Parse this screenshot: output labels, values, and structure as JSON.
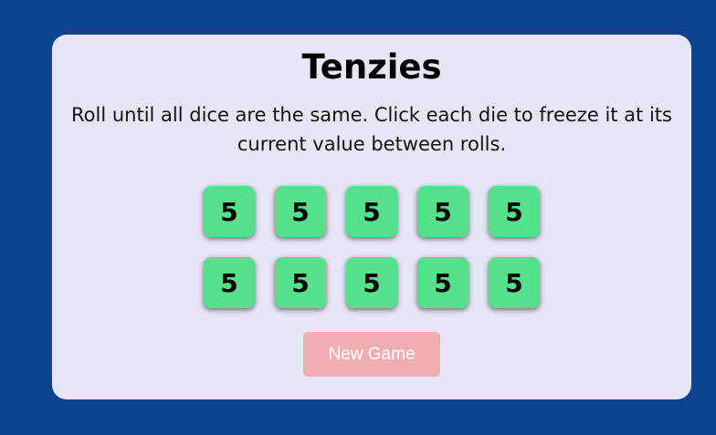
{
  "game": {
    "title": "Tenzies",
    "instructions": "Roll until all dice are the same. Click each die to freeze it at its current value between rolls.",
    "dice": [
      {
        "value": "5",
        "held": true
      },
      {
        "value": "5",
        "held": true
      },
      {
        "value": "5",
        "held": true
      },
      {
        "value": "5",
        "held": true
      },
      {
        "value": "5",
        "held": true
      },
      {
        "value": "5",
        "held": true
      },
      {
        "value": "5",
        "held": true
      },
      {
        "value": "5",
        "held": true
      },
      {
        "value": "5",
        "held": true
      },
      {
        "value": "5",
        "held": true
      }
    ],
    "new_game_label": "New Game"
  },
  "colors": {
    "page_background": "#0b438f",
    "board_background": "#e6e6f7",
    "held_die": "#55e08c",
    "unheld_die": "#ffffff",
    "new_game_button": "#f0aeb2"
  }
}
